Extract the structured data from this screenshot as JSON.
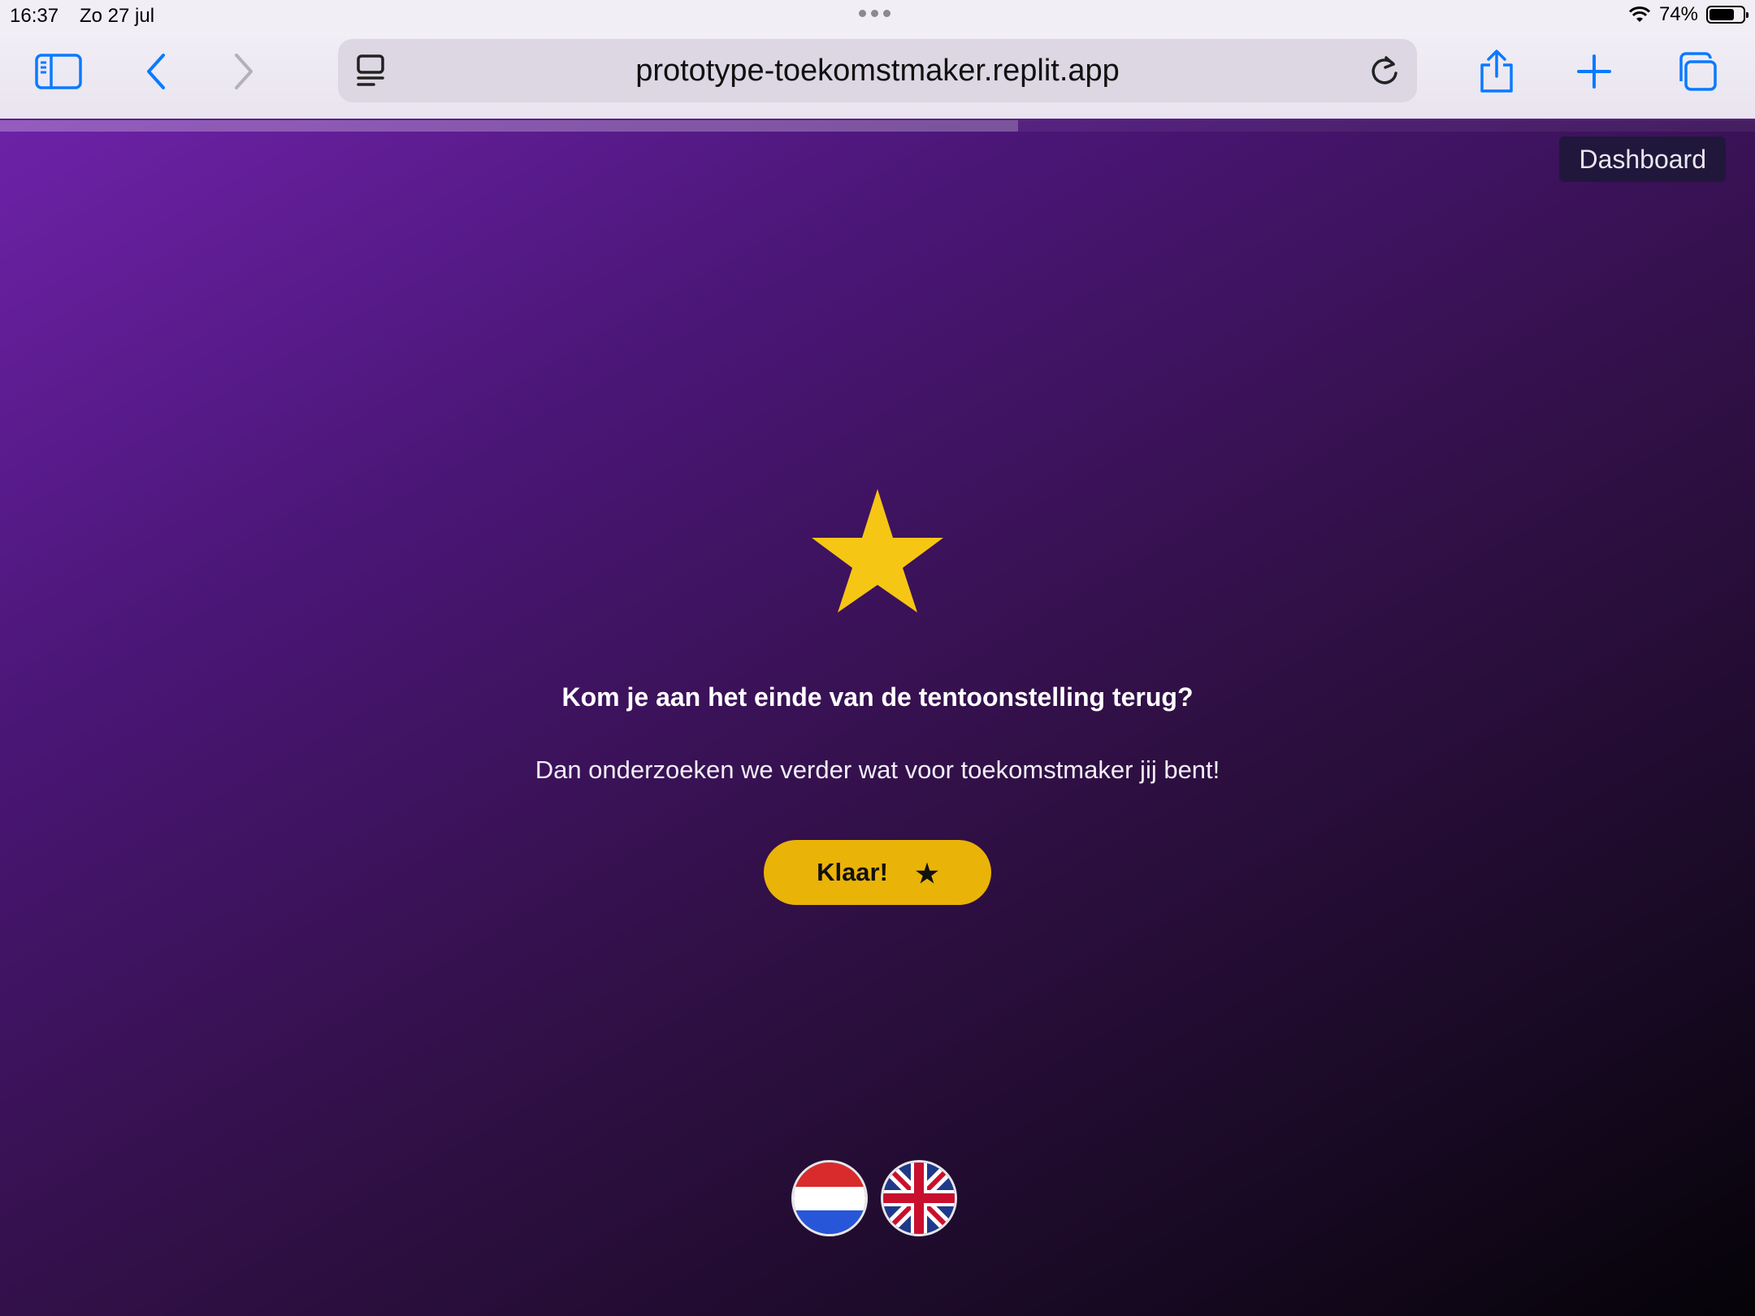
{
  "status_bar": {
    "time": "16:37",
    "date": "Zo 27 jul",
    "battery": "74%",
    "battery_level": 0.74
  },
  "browser": {
    "url": "prototype-toekomstmaker.replit.app",
    "icons": [
      "sidebar-icon",
      "back-icon",
      "forward-icon",
      "page-menu-icon",
      "reload-icon",
      "share-icon",
      "new-tab-icon",
      "tabs-icon"
    ],
    "accent_color": "#0a7aff"
  },
  "page": {
    "progress": 0.58,
    "dashboard_label": "Dashboard",
    "question": "Kom je aan het einde van de tentoonstelling terug?",
    "subtitle": "Dan onderzoeken we verder wat voor toekomstmaker jij bent!",
    "button_label": "Klaar!",
    "button_color": "#eab308",
    "star_color": "#f6c614",
    "languages": [
      "nl-flag-icon",
      "uk-flag-icon"
    ]
  }
}
